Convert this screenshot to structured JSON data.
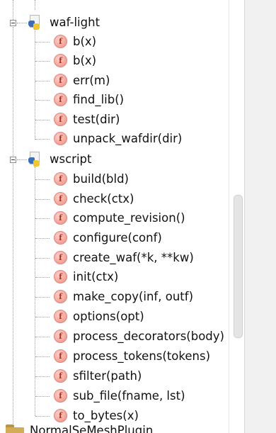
{
  "tree": {
    "files": [
      {
        "name": "waf-light",
        "functions": [
          "b(x)",
          "b(x)",
          "err(m)",
          "find_lib()",
          "test(dir)",
          "unpack_wafdir(dir)"
        ]
      },
      {
        "name": "wscript",
        "functions": [
          "build(bld)",
          "check(ctx)",
          "compute_revision()",
          "configure(conf)",
          "create_waf(*k, **kw)",
          "init(ctx)",
          "make_copy(inf, outf)",
          "options(opt)",
          "process_decorators(body)",
          "process_tokens(tokens)",
          "sfilter(path)",
          "sub_file(fname, lst)",
          "to_bytes(x)"
        ]
      }
    ],
    "function_badge": "f",
    "bottom_item": "NormalSeMeshPlugin"
  },
  "icons": {
    "file": "python-file-icon",
    "function": "function-icon",
    "toggle": "collapse-icon",
    "folder": "folder-icon"
  },
  "colors": {
    "badge_fill": "#f5a79c",
    "badge_text": "#b02a1a",
    "python_blue": "#3a6fb6",
    "python_yellow": "#f2c630"
  }
}
